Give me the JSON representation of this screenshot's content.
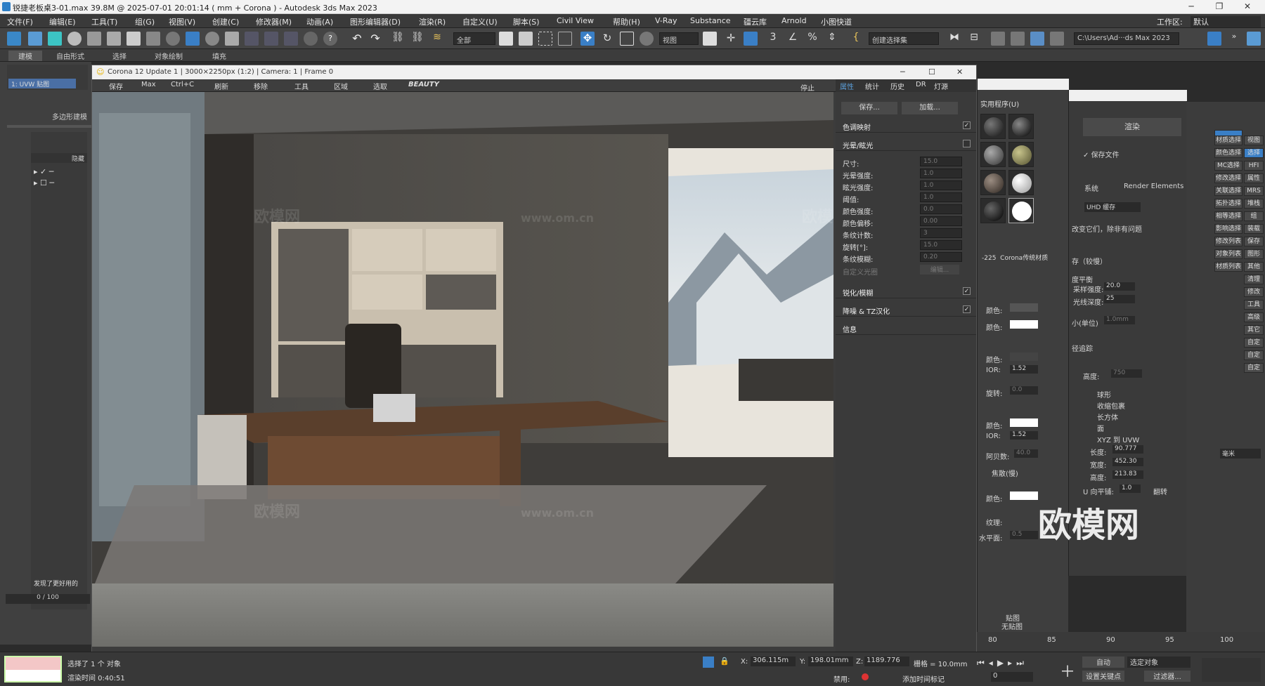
{
  "window": {
    "title": "锐捷老板桌3-01.max  39.8M @ 2025-07-01 20:01:14 ( mm + Corona ) - Autodesk 3ds Max 2023",
    "workspace_label": "工作区:",
    "workspace_value": "默认"
  },
  "menu": [
    "文件(F)",
    "编辑(E)",
    "工具(T)",
    "组(G)",
    "视图(V)",
    "创建(C)",
    "修改器(M)",
    "动画(A)",
    "图形编辑器(D)",
    "渲染(R)",
    "自定义(U)",
    "脚本(S)",
    "Civil View",
    "帮助(H)",
    "V-Ray",
    "Substance",
    "疆云库",
    "Arnold",
    "小图快道"
  ],
  "toolbar": {
    "filter": "全部",
    "view": "视图",
    "selset": "创建选择集",
    "path": "C:\\Users\\Ad···ds Max 2023"
  },
  "ribbon": [
    "建模",
    "自由形式",
    "选择",
    "对象绘制",
    "填充"
  ],
  "left": {
    "poly_label": "多边形建模",
    "uvw": "1: UVW 贴图",
    "hide_header": "隐藏",
    "frame": "0 / 100",
    "notice": "发现了更好用的"
  },
  "vfb": {
    "title": "Corona 12 Update 1 | 3000×2250px (1:2) | Camera: 1 | Frame 0",
    "tools": [
      "保存",
      "Max",
      "Ctrl+C",
      "刷新",
      "移除",
      "工具",
      "区域",
      "选取"
    ],
    "beauty": "BEAUTY",
    "stop": "停止",
    "render_btn": "渲染",
    "tabs": [
      "属性",
      "统计",
      "历史",
      "DR",
      "灯源"
    ],
    "save_btn": "保存...",
    "load_btn": "加载...",
    "sec_tonemap": "色调映射",
    "sec_bloom": "光晕/眩光",
    "sec_sharpen": "锐化/模糊",
    "sec_denoise": "降噪 & TZ汉化",
    "sec_info": "信息",
    "rows": [
      {
        "l": "尺寸:",
        "v": "15.0"
      },
      {
        "l": "光晕强度:",
        "v": "1.0"
      },
      {
        "l": "眩光强度:",
        "v": "1.0"
      },
      {
        "l": "阈值:",
        "v": "1.0"
      },
      {
        "l": "颜色强度:",
        "v": "0.0"
      },
      {
        "l": "颜色偏移:",
        "v": "0.00"
      },
      {
        "l": "条纹计数:",
        "v": "3"
      },
      {
        "l": "旋转[°]:",
        "v": "15.0"
      },
      {
        "l": "条纹模糊:",
        "v": "0.20"
      }
    ],
    "custom_bloom": "自定义光圈",
    "edit_btn": "编辑..."
  },
  "mated": {
    "menu": "实用程序(U)",
    "mat_num": "-225",
    "mat_name": "Corona传统材质",
    "labels": [
      "颜色:",
      "颜色:",
      "颜色:",
      "IOR:",
      "旋转:",
      "颜色:",
      "IOR:",
      "阿贝数:",
      "焦散(慢)",
      "颜色:",
      "纹理:",
      "水平面:"
    ],
    "ior1": "1.52",
    "ior2": "1.52",
    "rot": "0.0",
    "abbe": "40.0",
    "level": "0.5",
    "map_label": "贴图",
    "nomap": "无贴图"
  },
  "render_setup": {
    "render_btn": "渲染",
    "save_file": "保存文件",
    "tab_system": "系统",
    "tab_elements": "Render Elements",
    "vfb_mode": "UHD 缓存",
    "note": "改变它们，除非有问题",
    "save_label": "存（较慢）",
    "balance": "度平衡",
    "sample": "采样强度:",
    "sample_v": "20.0",
    "depth": "光线深度:",
    "depth_v": "25",
    "unit": "小(单位)",
    "unit_v": "1.0mm",
    "path": "径追踪",
    "height": "高度:",
    "height_v": "750"
  },
  "modifier": {
    "opts": [
      "球形",
      "收缩包裹",
      "长方体",
      "面",
      "XYZ 到 UVW"
    ],
    "len": "长度:",
    "len_v": "90.777",
    "wid": "宽度:",
    "wid_v": "452.30",
    "hei": "高度:",
    "hei_v": "213.83",
    "uflip": "U 向平铺:",
    "uflip_v": "1.0",
    "flip": "翻转",
    "unit_dd": "毫米"
  },
  "rightbtns": [
    "材质选择",
    "视图",
    "颜色选择",
    "选择",
    "MC选择",
    "HFI",
    "修改选择",
    "属性",
    "关联选择",
    "MRS",
    "拓扑选择",
    "堆栈",
    "相等选择",
    "组",
    "影响选择",
    "装载",
    "修改列表",
    "保存",
    "对象列表",
    "图形",
    "材质列表",
    "其他",
    "清理",
    "修改",
    "工具",
    "高级",
    "其它",
    "自定",
    "自定",
    "自定"
  ],
  "timeline": {
    "ticks": [
      "80",
      "85",
      "90",
      "95",
      "100"
    ]
  },
  "status": {
    "selected": "选择了 1 个 对象",
    "render_time": "渲染时间  0:40:51",
    "x": "306.115m",
    "y": "198.01mm",
    "z": "1189.776",
    "grid": "栅格 = 10.0mm",
    "auto": "自动",
    "selset": "选定对象",
    "keyset": "设置关键点",
    "filters": "过滤器...",
    "frame": "0",
    "disable": "禁用:",
    "addtime": "添加时间标记"
  },
  "watermark": {
    "text": "欧模网",
    "url": "www.om.cn"
  }
}
